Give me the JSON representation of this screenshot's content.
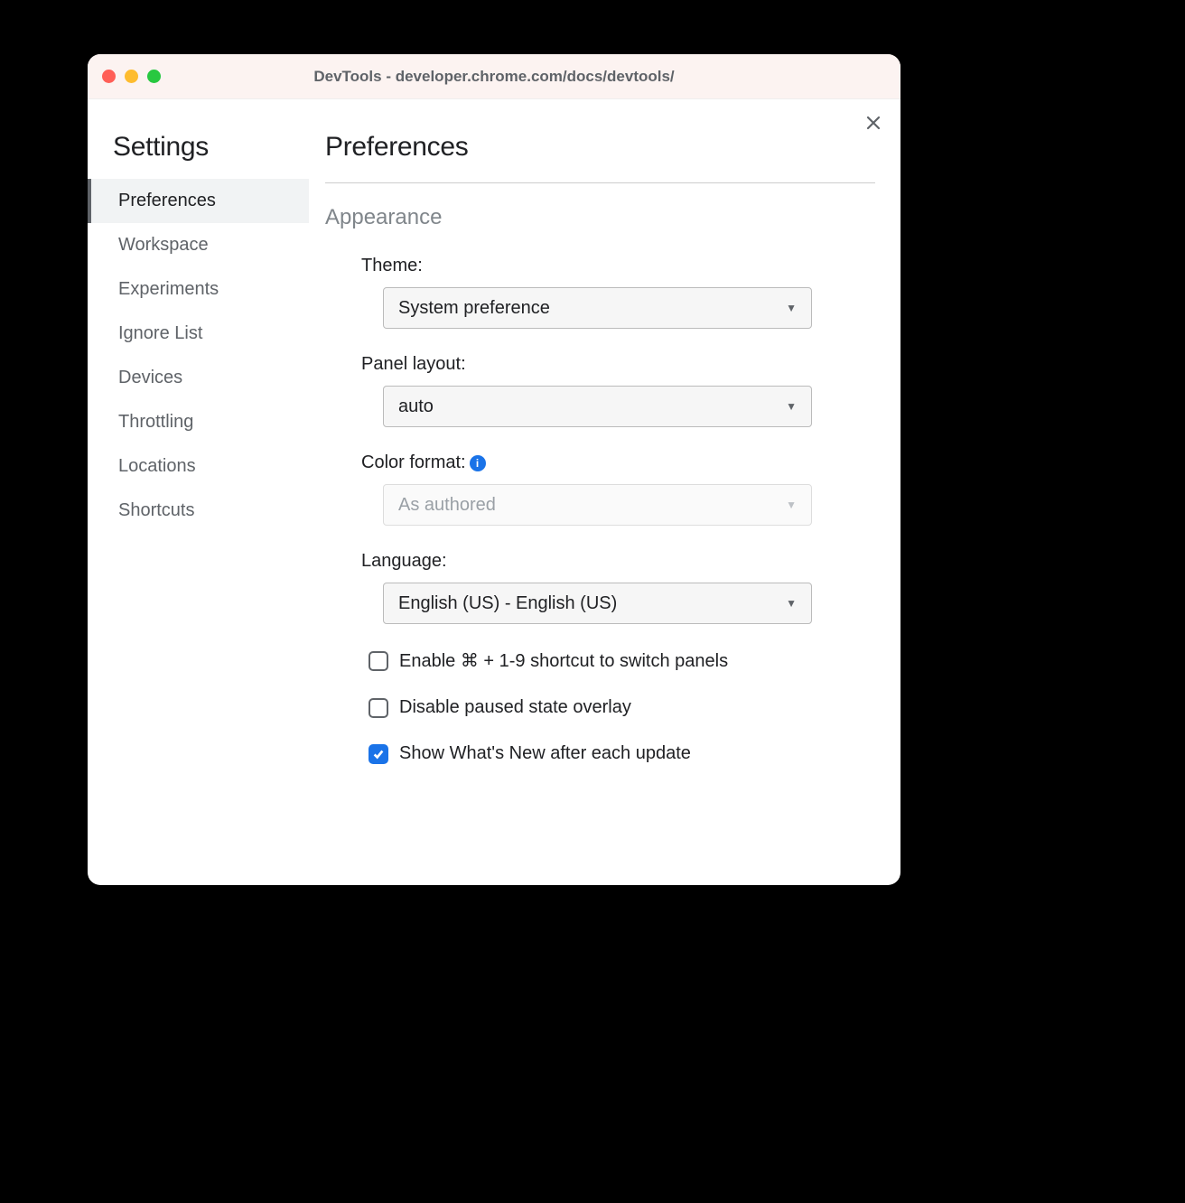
{
  "window": {
    "title": "DevTools - developer.chrome.com/docs/devtools/"
  },
  "sidebar": {
    "heading": "Settings",
    "items": [
      {
        "label": "Preferences",
        "active": true
      },
      {
        "label": "Workspace",
        "active": false
      },
      {
        "label": "Experiments",
        "active": false
      },
      {
        "label": "Ignore List",
        "active": false
      },
      {
        "label": "Devices",
        "active": false
      },
      {
        "label": "Throttling",
        "active": false
      },
      {
        "label": "Locations",
        "active": false
      },
      {
        "label": "Shortcuts",
        "active": false
      }
    ]
  },
  "main": {
    "heading": "Preferences",
    "section": "Appearance",
    "fields": {
      "theme": {
        "label": "Theme:",
        "value": "System preference",
        "disabled": false
      },
      "panelLayout": {
        "label": "Panel layout:",
        "value": "auto",
        "disabled": false
      },
      "colorFormat": {
        "label": "Color format:",
        "value": "As authored",
        "disabled": true
      },
      "language": {
        "label": "Language:",
        "value": "English (US) - English (US)",
        "disabled": false
      }
    },
    "checkboxes": [
      {
        "label": "Enable ⌘ + 1-9 shortcut to switch panels",
        "checked": false
      },
      {
        "label": "Disable paused state overlay",
        "checked": false
      },
      {
        "label": "Show What's New after each update",
        "checked": true
      }
    ]
  }
}
